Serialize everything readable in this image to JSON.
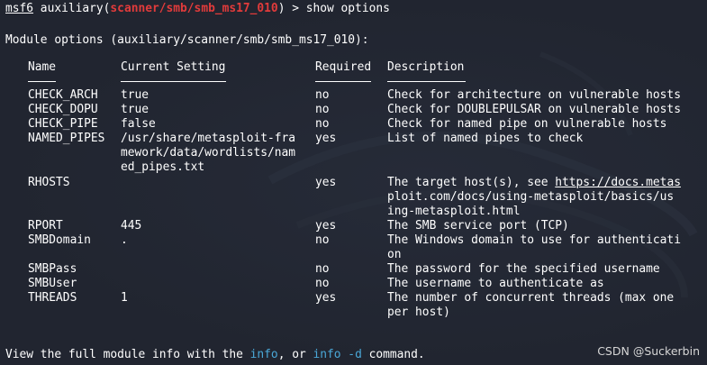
{
  "prompt": {
    "prefix": "msf6",
    "command_word": " auxiliary(",
    "module_path": "scanner/smb/smb_ms17_010",
    "suffix": ") > show options"
  },
  "heading": "Module options (auxiliary/scanner/smb/smb_ms17_010):",
  "table": {
    "headers": {
      "name": "Name",
      "setting": "Current Setting",
      "required": "Required",
      "description": "Description"
    },
    "rows": [
      {
        "name": "CHECK_ARCH",
        "setting": [
          "true"
        ],
        "required": "no",
        "description": [
          "Check for architecture on vulnerable hosts"
        ]
      },
      {
        "name": "CHECK_DOPU",
        "setting": [
          "true"
        ],
        "required": "no",
        "description": [
          "Check for DOUBLEPULSAR on vulnerable hosts"
        ]
      },
      {
        "name": "CHECK_PIPE",
        "setting": [
          "false"
        ],
        "required": "no",
        "description": [
          "Check for named pipe on vulnerable hosts"
        ]
      },
      {
        "name": "NAMED_PIPES",
        "setting": [
          "/usr/share/metasploit-fra",
          "mework/data/wordlists/nam",
          "ed_pipes.txt"
        ],
        "required": "yes",
        "description": [
          "List of named pipes to check"
        ]
      },
      {
        "name": "RHOSTS",
        "setting": [
          ""
        ],
        "required": "yes",
        "description_parts": {
          "before": "The target host(s), see ",
          "url1": "https://docs.metas",
          "url2": "ploit.com/docs/using-metasploit/basics/us",
          "url3": "ing-metasploit.html"
        }
      },
      {
        "name": "RPORT",
        "setting": [
          "445"
        ],
        "required": "yes",
        "description": [
          "The SMB service port (TCP)"
        ]
      },
      {
        "name": "SMBDomain",
        "setting": [
          "."
        ],
        "required": "no",
        "description": [
          "The Windows domain to use for authenticati",
          "on"
        ]
      },
      {
        "name": "SMBPass",
        "setting": [
          ""
        ],
        "required": "no",
        "description": [
          "The password for the specified username"
        ]
      },
      {
        "name": "SMBUser",
        "setting": [
          ""
        ],
        "required": "no",
        "description": [
          "The username to authenticate as"
        ]
      },
      {
        "name": "THREADS",
        "setting": [
          "1"
        ],
        "required": "yes",
        "description": [
          "The number of concurrent threads (max one",
          "per host)"
        ]
      }
    ]
  },
  "footer": {
    "before": "View the full module info with the ",
    "cmd1": "info",
    "middle": ", or ",
    "cmd2": "info -d",
    "after": " command."
  },
  "watermark": "CSDN @Suckerbin",
  "colors": {
    "background": "#212530",
    "module_red": "#e23b3b",
    "command_blue": "#4aa8d8",
    "text": "#ffffff"
  }
}
